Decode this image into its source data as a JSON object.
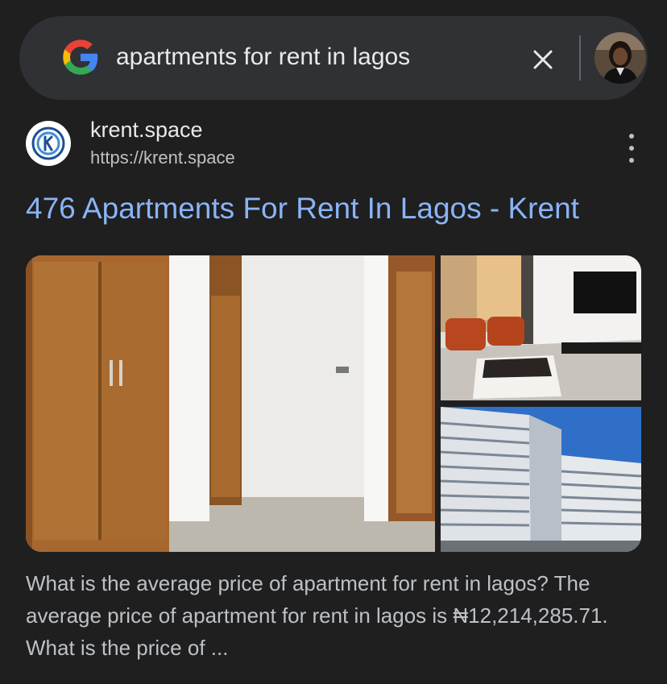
{
  "search": {
    "query": "apartments for rent in lagos",
    "clear_icon": "close-icon",
    "logo": "google-g-logo",
    "avatar": "user-avatar"
  },
  "result": {
    "site_name": "krent.space",
    "site_url": "https://krent.space",
    "favicon": "krent-k-logo",
    "menu_icon": "more-vertical-icon",
    "title": "476 Apartments For Rent In Lagos - Krent",
    "images": [
      "empty-room-with-wardrobe",
      "living-room-with-orange-chairs",
      "apartment-building-exterior"
    ],
    "snippet": "What is the average price of apartment for rent in lagos? The average price of apartment for rent in lagos is ₦12,214,285.71. What is the price of ..."
  },
  "colors": {
    "background": "#1f1f1f",
    "search_bar": "#303134",
    "link": "#8ab4f8",
    "text": "#e8eaed",
    "secondary_text": "#bdc1c6"
  }
}
